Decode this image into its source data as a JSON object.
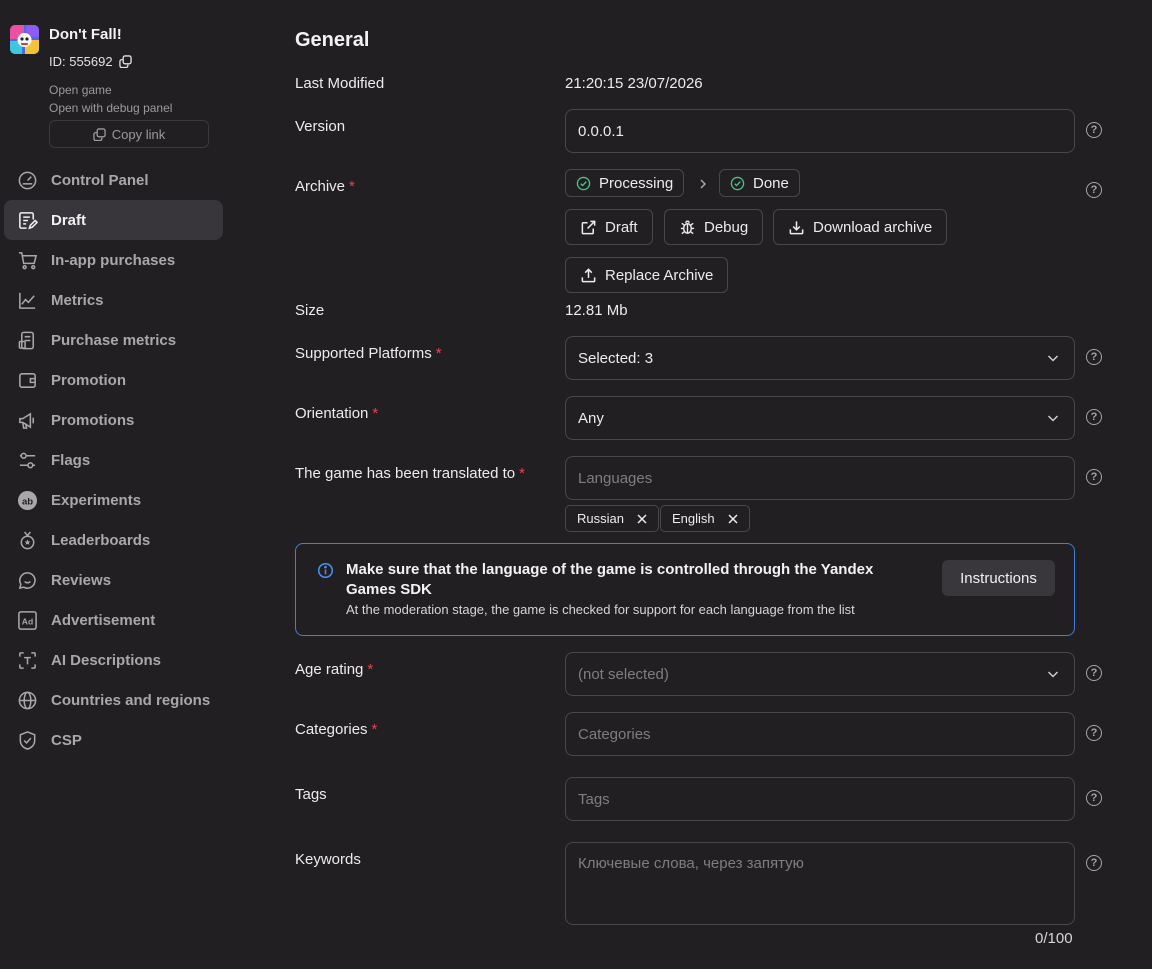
{
  "app": {
    "name": "Don't Fall!",
    "id": "ID: 555692",
    "open_game": "Open game",
    "open_debug": "Open with debug panel",
    "copy_link": "Copy link"
  },
  "sidebar": {
    "items": [
      {
        "label": "Control Panel",
        "icon": "gauge-icon"
      },
      {
        "label": "Draft",
        "icon": "edit-document-icon",
        "active": true
      },
      {
        "label": "In-app purchases",
        "icon": "cart-icon"
      },
      {
        "label": "Metrics",
        "icon": "line-chart-icon"
      },
      {
        "label": "Purchase metrics",
        "icon": "purchase-metrics-icon"
      },
      {
        "label": "Promotion",
        "icon": "wallet-icon"
      },
      {
        "label": "Promotions",
        "icon": "megaphone-icon"
      },
      {
        "label": "Flags",
        "icon": "sliders-icon"
      },
      {
        "label": "Experiments",
        "icon": "ab-icon"
      },
      {
        "label": "Leaderboards",
        "icon": "medal-icon"
      },
      {
        "label": "Reviews",
        "icon": "chat-bubble-icon"
      },
      {
        "label": "Advertisement",
        "icon": "ad-icon"
      },
      {
        "label": "AI Descriptions",
        "icon": "text-frame-icon"
      },
      {
        "label": "Countries and regions",
        "icon": "globe-icon"
      },
      {
        "label": "CSP",
        "icon": "shield-check-icon"
      }
    ]
  },
  "main": {
    "heading": "General",
    "last_modified": {
      "label": "Last Modified",
      "value": "21:20:15 23/07/2026"
    },
    "version": {
      "label": "Version",
      "value": "0.0.0.1"
    },
    "archive": {
      "label": "Archive",
      "req": "*",
      "status_processing": "Processing",
      "status_done": "Done",
      "draft_btn": "Draft",
      "debug_btn": "Debug",
      "download_btn": "Download archive",
      "replace_btn": "Replace Archive"
    },
    "size": {
      "label": "Size",
      "value": "12.81 Mb"
    },
    "platforms": {
      "label": "Supported Platforms",
      "req": "*",
      "value": "Selected: 3"
    },
    "orientation": {
      "label": "Orientation",
      "req": "*",
      "value": "Any"
    },
    "translated": {
      "label": "The game has been translated to",
      "req": "*",
      "placeholder": "Languages",
      "languages": [
        "Russian",
        "English"
      ]
    },
    "notice": {
      "title": "Make sure that the language of the game is controlled through the Yandex Games SDK",
      "text": "At the moderation stage, the game is checked for support for each language from the list",
      "button": "Instructions"
    },
    "age_rating": {
      "label": "Age rating",
      "req": "*",
      "value": "(not selected)"
    },
    "categories": {
      "label": "Categories",
      "req": "*",
      "placeholder": "Categories"
    },
    "tags": {
      "label": "Tags",
      "placeholder": "Tags"
    },
    "keywords": {
      "label": "Keywords",
      "placeholder": "Ключевые слова, через запятую",
      "counter": "0/100"
    },
    "help_glyph": "?"
  },
  "colors": {
    "background": "#221f23",
    "accent_blue": "#3f7fd9",
    "required_red": "#e6454e",
    "success_green": "#4cc38a"
  }
}
